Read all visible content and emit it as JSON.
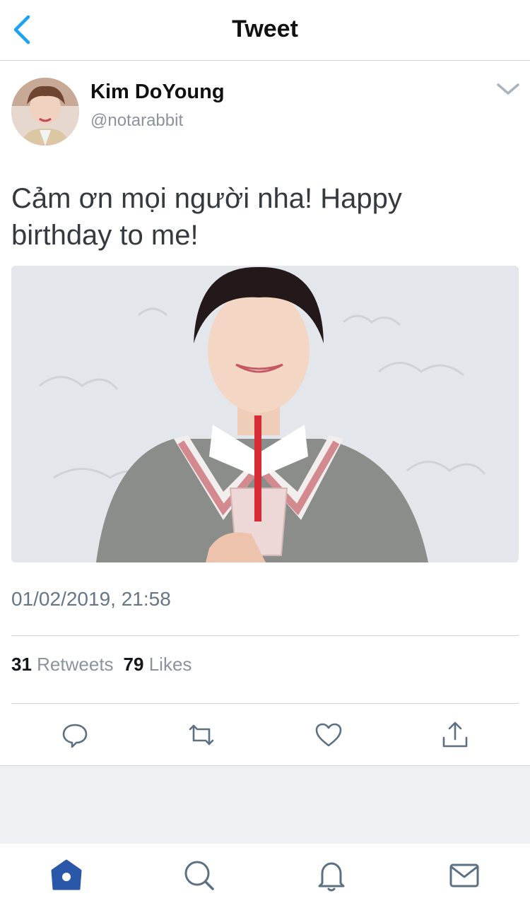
{
  "header": {
    "title": "Tweet",
    "back_icon": "chevron-left-icon"
  },
  "tweet": {
    "author": {
      "display_name": "Kim DoYoung",
      "handle": "@notarabbit"
    },
    "text": "Cảm ơn mọi người nha! Happy birthday to me!",
    "timestamp": "01/02/2019, 21:58",
    "stats": {
      "retweets_count": "31",
      "retweets_label": "Retweets",
      "likes_count": "79",
      "likes_label": "Likes"
    }
  },
  "actions": [
    "reply-icon",
    "retweet-icon",
    "like-icon",
    "share-icon"
  ],
  "tabbar": {
    "items": [
      "home-icon",
      "search-icon",
      "notifications-icon",
      "messages-icon"
    ],
    "active": "home-icon"
  },
  "colors": {
    "accent": "#1da1f2",
    "active_tab": "#2a57a8",
    "secondary_text": "#8a949e"
  }
}
